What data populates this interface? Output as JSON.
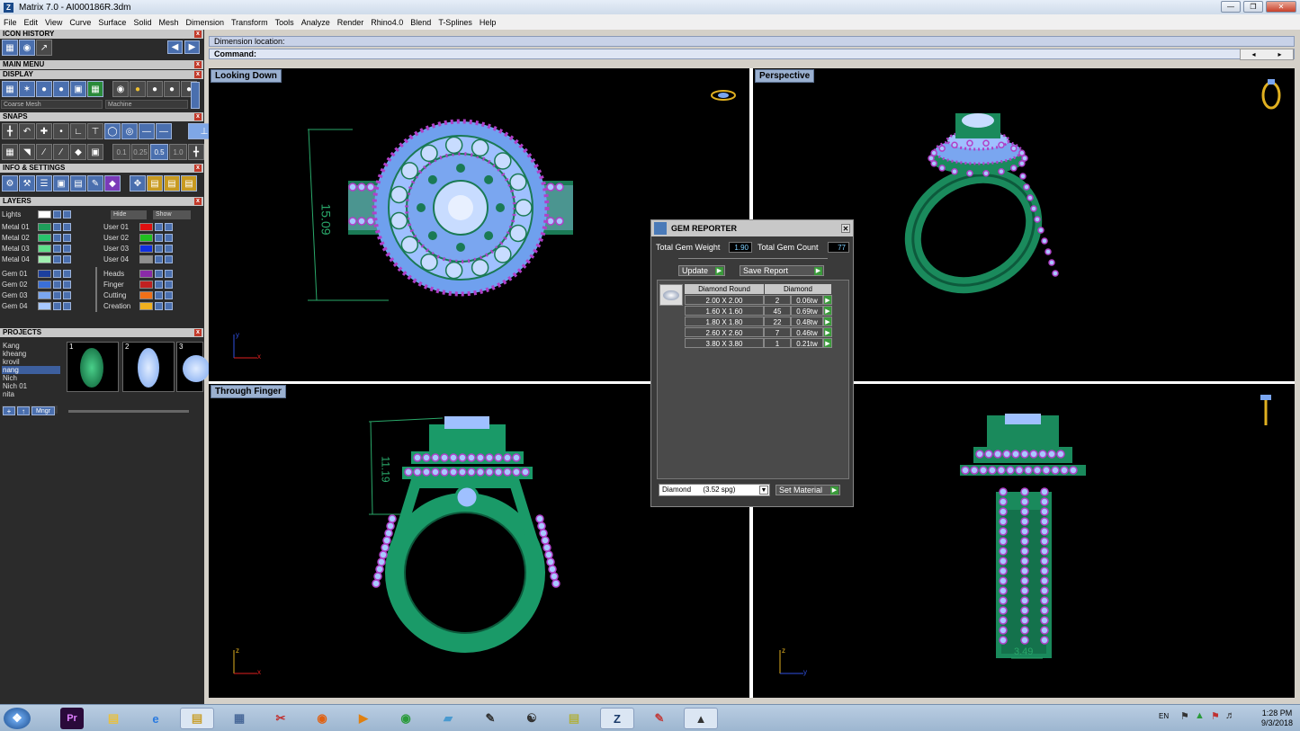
{
  "window": {
    "title": "Matrix 7.0 - AI000186R.3dm",
    "app_icon": "Z"
  },
  "menu": [
    "File",
    "Edit",
    "View",
    "Curve",
    "Surface",
    "Solid",
    "Mesh",
    "Dimension",
    "Transform",
    "Tools",
    "Analyze",
    "Render",
    "Rhino4.0",
    "Blend",
    "T-Splines",
    "Help"
  ],
  "left": {
    "icon_history": "ICON HISTORY",
    "main_menu": "MAIN MENU",
    "display": "DISPLAY",
    "display_mesh": "Coarse Mesh",
    "display_material": "Machine",
    "snaps": "SNAPS",
    "snap_values": [
      "0.1",
      "0.25",
      "0.5",
      "1.0"
    ],
    "info_settings": "INFO & SETTINGS",
    "layers_title": "LAYERS",
    "lights_label": "Lights",
    "hide_label": "Hide",
    "show_label": "Show",
    "layers_left": [
      {
        "name": "Metal 01",
        "color": "#1e9e5a"
      },
      {
        "name": "Metal 02",
        "color": "#28c46c"
      },
      {
        "name": "Metal 03",
        "color": "#5ee08a"
      },
      {
        "name": "Metal 04",
        "color": "#a0f0b0"
      },
      {
        "name": "Gem 01",
        "color": "#1c3f9e"
      },
      {
        "name": "Gem 02",
        "color": "#3a6fd8"
      },
      {
        "name": "Gem 03",
        "color": "#7aa6f0"
      },
      {
        "name": "Gem 04",
        "color": "#a8c8ff"
      }
    ],
    "layers_right": [
      {
        "name": "User 01",
        "color": "#e01010"
      },
      {
        "name": "User 02",
        "color": "#20c020"
      },
      {
        "name": "User 03",
        "color": "#1030e0"
      },
      {
        "name": "User 04",
        "color": "#909090"
      },
      {
        "name": "Heads",
        "color": "#8a2aa8"
      },
      {
        "name": "Finger",
        "color": "#c02020"
      },
      {
        "name": "Cutting",
        "color": "#f07018"
      },
      {
        "name": "Creation",
        "color": "#f0b020"
      }
    ],
    "projects_title": "PROJECTS",
    "projects": [
      "Kang",
      "kheang",
      "krovil",
      "nang",
      "Nich",
      "Nich 01",
      "nita"
    ],
    "selected_project": "nang",
    "thumbnails": [
      "1",
      "2",
      "3"
    ],
    "mngr_label": "Mngr"
  },
  "command": {
    "line1": "Dimension location:",
    "line2_label": "Command:"
  },
  "viewports": {
    "top_left": "Looking Down",
    "top_right": "Perspective",
    "bottom_left": "Through Finger",
    "dim_top": "15.09",
    "dim_front": "11.19",
    "dim_side": "3.49",
    "axis_x": "x",
    "axis_y": "y",
    "axis_z": "z"
  },
  "gem_reporter": {
    "title": "GEM REPORTER",
    "total_weight_label": "Total Gem Weight",
    "total_weight": "1.90",
    "total_count_label": "Total Gem Count",
    "total_count": "77",
    "update_label": "Update",
    "save_label": "Save Report",
    "col_shape": "Diamond Round",
    "col_material": "Diamond",
    "rows": [
      {
        "size": "2.00 X 2.00",
        "count": "2",
        "weight": "0.06tw"
      },
      {
        "size": "1.60 X 1.60",
        "count": "45",
        "weight": "0.69tw"
      },
      {
        "size": "1.80 X 1.80",
        "count": "22",
        "weight": "0.48tw"
      },
      {
        "size": "2.60 X 2.60",
        "count": "7",
        "weight": "0.46tw"
      },
      {
        "size": "3.80 X 3.80",
        "count": "1",
        "weight": "0.21tw"
      }
    ],
    "material_select": "Diamond      (3.52 spg)",
    "set_material_label": "Set Material"
  },
  "taskbar": {
    "icons": [
      "start-orb",
      "premiere",
      "folder",
      "ie",
      "explorer",
      "calculator",
      "scissors",
      "firefox",
      "media",
      "chrome",
      "eraser",
      "pen-tool",
      "zbrush",
      "notepad",
      "matrix-z",
      "paint",
      "rhino"
    ],
    "premiere_text": "Pr",
    "matrix_text": "Z",
    "lang": "EN",
    "time": "1:28 PM",
    "date": "9/3/2018"
  }
}
